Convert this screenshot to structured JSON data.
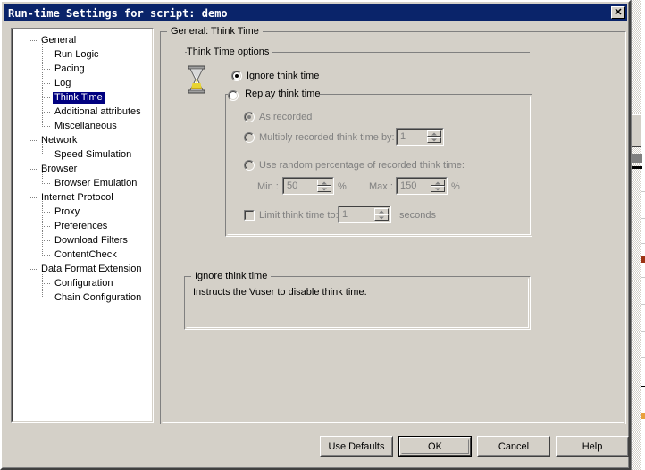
{
  "window": {
    "title": "Run-time Settings for script: demo",
    "close_button": "✕",
    "close_icon_name": "close-icon"
  },
  "tree": {
    "selected": "Think Time",
    "nodes": [
      {
        "label": "General",
        "level": 0
      },
      {
        "label": "Run Logic",
        "level": 1
      },
      {
        "label": "Pacing",
        "level": 1
      },
      {
        "label": "Log",
        "level": 1
      },
      {
        "label": "Think Time",
        "level": 1,
        "selected": true
      },
      {
        "label": "Additional attributes",
        "level": 1
      },
      {
        "label": "Miscellaneous",
        "level": 1
      },
      {
        "label": "Network",
        "level": 0
      },
      {
        "label": "Speed Simulation",
        "level": 1
      },
      {
        "label": "Browser",
        "level": 0
      },
      {
        "label": "Browser Emulation",
        "level": 1
      },
      {
        "label": "Internet Protocol",
        "level": 0
      },
      {
        "label": "Proxy",
        "level": 1
      },
      {
        "label": "Preferences",
        "level": 1
      },
      {
        "label": "Download Filters",
        "level": 1
      },
      {
        "label": "ContentCheck",
        "level": 1
      },
      {
        "label": "Data Format Extension",
        "level": 0
      },
      {
        "label": "Configuration",
        "level": 1
      },
      {
        "label": "Chain Configuration",
        "level": 1
      }
    ]
  },
  "panel": {
    "title": "General: Think Time",
    "options_group_title": "Think Time options",
    "icon_name": "hourglass-icon",
    "ignore_think_time": {
      "label": "Ignore think time",
      "checked": true,
      "enabled": true
    },
    "replay_think_time": {
      "label": "Replay think time",
      "checked": false,
      "enabled": true
    },
    "as_recorded": {
      "label": "As recorded",
      "checked": true,
      "enabled": false
    },
    "multiply": {
      "label": "Multiply recorded think time by:",
      "checked": false,
      "enabled": false,
      "value": "1"
    },
    "random_percentage": {
      "label": "Use random percentage of recorded think time:",
      "checked": false,
      "enabled": false
    },
    "min": {
      "label": "Min :",
      "value": "50",
      "unit": "%"
    },
    "max": {
      "label": "Max :",
      "value": "150",
      "unit": "%"
    },
    "limit": {
      "label": "Limit think time to:",
      "checked": false,
      "enabled": false,
      "value": "1",
      "unit": "seconds"
    }
  },
  "description": {
    "title": "Ignore think time",
    "text": "Instructs the Vuser to disable think time."
  },
  "buttons": {
    "use_defaults": "Use Defaults",
    "ok": "OK",
    "cancel": "Cancel",
    "help": "Help"
  },
  "colors": {
    "titlebar": "#0a2f7c",
    "face": "#d4d0c8",
    "selection": "#000080",
    "disabled_text": "#808080"
  }
}
